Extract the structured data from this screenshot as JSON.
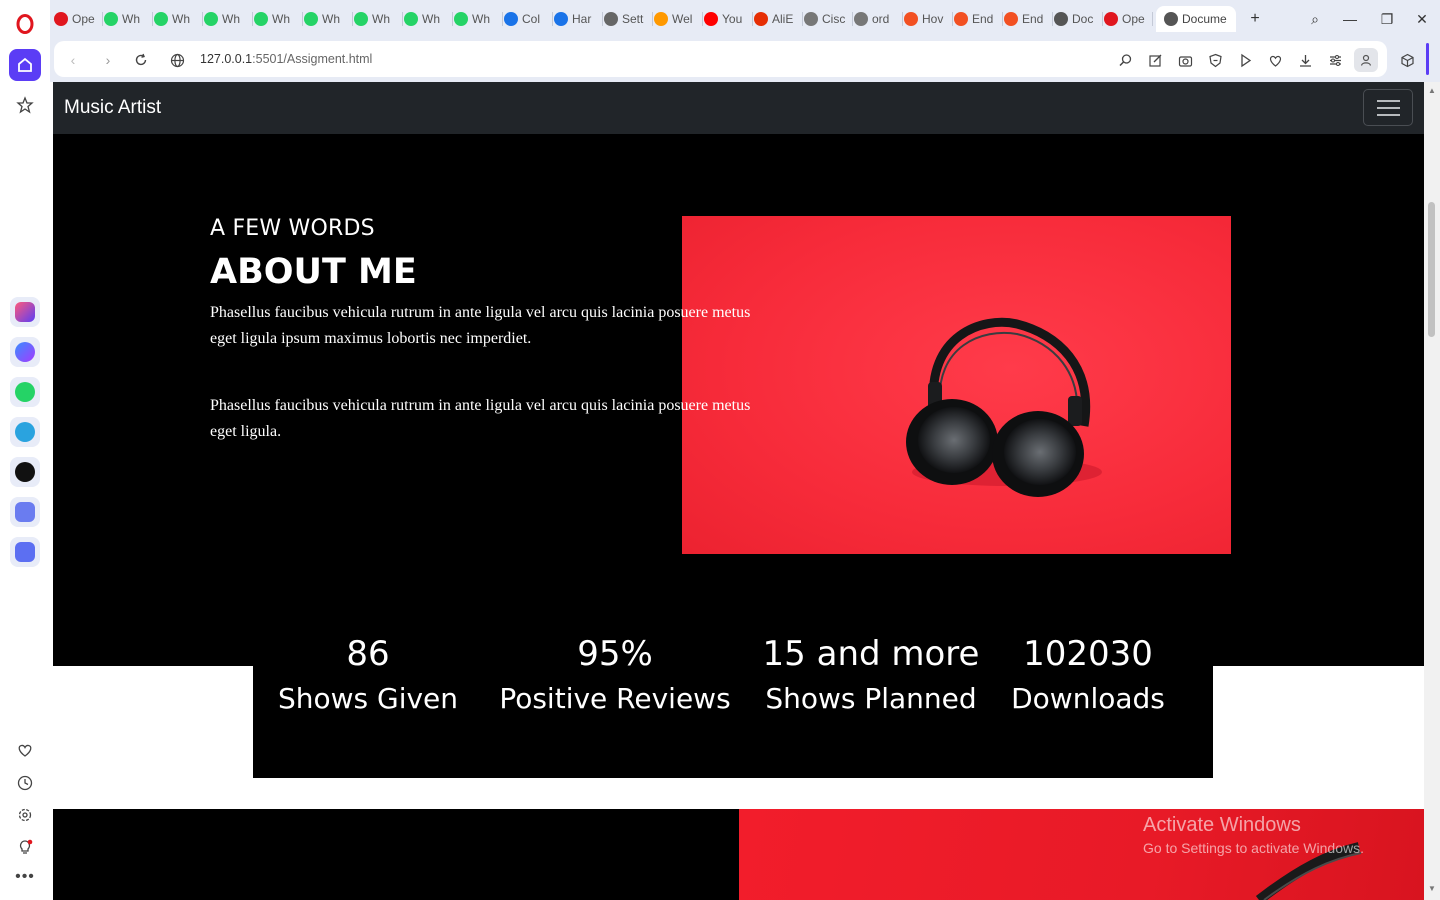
{
  "browser": {
    "tabs": [
      {
        "label": "Ope",
        "color": "#e0161e"
      },
      {
        "label": "Wh",
        "color": "#25d366"
      },
      {
        "label": "Wh",
        "color": "#25d366"
      },
      {
        "label": "Wh",
        "color": "#25d366"
      },
      {
        "label": "Wh",
        "color": "#25d366"
      },
      {
        "label": "Wh",
        "color": "#25d366"
      },
      {
        "label": "Wh",
        "color": "#25d366"
      },
      {
        "label": "Wh",
        "color": "#25d366"
      },
      {
        "label": "Wh",
        "color": "#25d366"
      },
      {
        "label": "Col",
        "color": "#1a73e8"
      },
      {
        "label": "Har",
        "color": "#1a73e8"
      },
      {
        "label": "Sett",
        "color": "#666666"
      },
      {
        "label": "Wel",
        "color": "#ff9900"
      },
      {
        "label": "You",
        "color": "#ff0000"
      },
      {
        "label": "AliE",
        "color": "#e62e04"
      },
      {
        "label": "Cisc",
        "color": "#777777"
      },
      {
        "label": "ord",
        "color": "#777777"
      },
      {
        "label": "Hov",
        "color": "#f25022"
      },
      {
        "label": "End",
        "color": "#f25022"
      },
      {
        "label": "End",
        "color": "#f25022"
      },
      {
        "label": "Doc",
        "color": "#555555"
      },
      {
        "label": "Ope",
        "color": "#e0161e"
      }
    ],
    "active_tab": {
      "label": "Docume",
      "color": "#555555"
    },
    "new_tab_label": "+",
    "url_host": "127.0.0.1",
    "url_rest": ":5501/Assigment.html"
  },
  "page": {
    "brand": "Music Artist",
    "about": {
      "eyebrow": "A FEW WORDS",
      "heading": "ABOUT ME",
      "paragraph_1": "Phasellus faucibus vehicula rutrum in ante ligula vel arcu quis lacinia posuere metus eget ligula ipsum maximus lobortis nec imperdiet.",
      "paragraph_2": "Phasellus faucibus vehicula rutrum in ante ligula vel arcu quis lacinia posuere metus eget ligula."
    },
    "stats": [
      {
        "value": "86",
        "label": "Shows Given"
      },
      {
        "value": "95%",
        "label": "Positive Reviews"
      },
      {
        "value": "15 and more",
        "label": "Shows Planned"
      },
      {
        "value": "102030",
        "label": "Downloads"
      }
    ]
  },
  "watermark": {
    "title": "Activate Windows",
    "subtitle": "Go to Settings to activate Windows."
  },
  "colors": {
    "navbar": "#212529",
    "accent_red": "#f72b3a",
    "opera_red": "#e0161e"
  }
}
